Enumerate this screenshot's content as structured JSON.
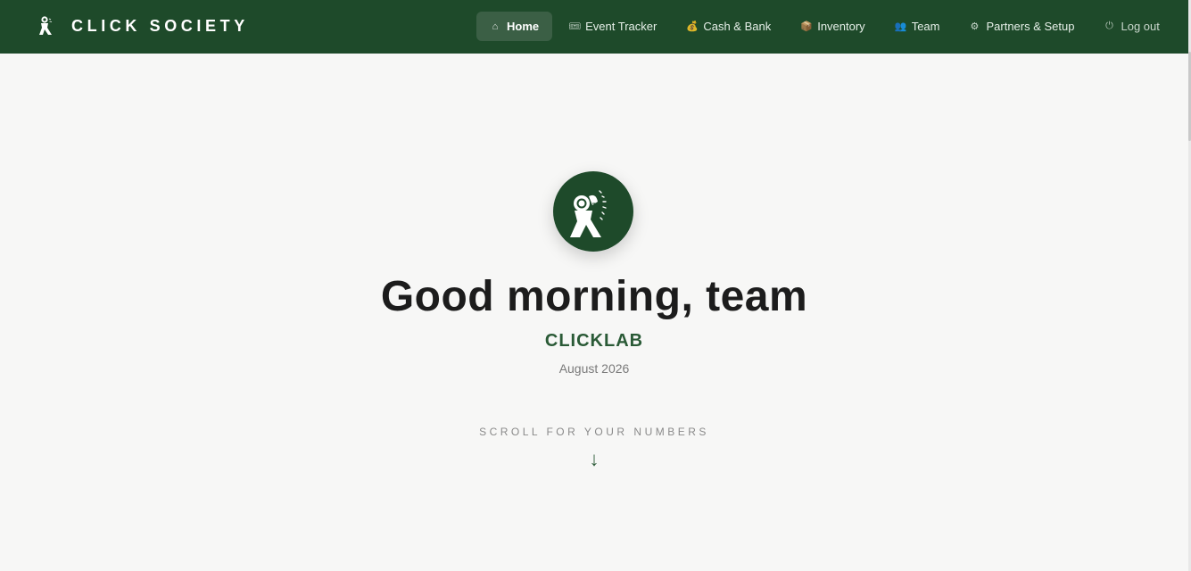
{
  "brand": {
    "name": "CLICK SOCIETY",
    "logo_icon": "runner-logo-icon"
  },
  "nav": {
    "items": [
      {
        "label": "Home",
        "icon": "⌂",
        "icon_name": "home-icon",
        "active": true
      },
      {
        "label": "Event Tracker",
        "icon": "🎟",
        "icon_name": "ticket-icon",
        "active": false
      },
      {
        "label": "Cash & Bank",
        "icon": "💰",
        "icon_name": "money-bag-icon",
        "active": false
      },
      {
        "label": "Inventory",
        "icon": "📦",
        "icon_name": "package-icon",
        "active": false
      },
      {
        "label": "Team",
        "icon": "👥",
        "icon_name": "team-icon",
        "active": false
      },
      {
        "label": "Partners & Setup",
        "icon": "⚙",
        "icon_name": "gear-icon",
        "active": false
      },
      {
        "label": "Log out",
        "icon": "⏻",
        "icon_name": "power-icon",
        "active": false
      }
    ]
  },
  "hero": {
    "greeting": "Good morning, team",
    "organization": "CLICKLAB",
    "period": "August 2026",
    "scroll_hint": "SCROLL FOR YOUR NUMBERS",
    "arrow": "↓"
  },
  "colors": {
    "brand_green": "#1e4a2a",
    "accent_green": "#2a5a36",
    "active_tab": "#3b5f45",
    "background": "#f7f7f6"
  }
}
